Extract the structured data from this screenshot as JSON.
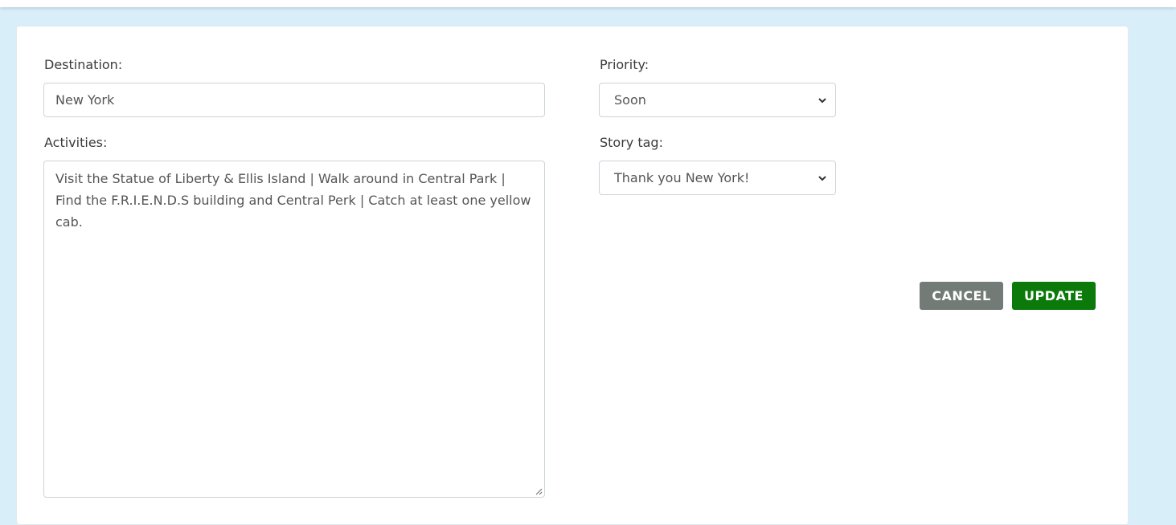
{
  "form": {
    "destination": {
      "label": "Destination:",
      "value": "New York"
    },
    "activities": {
      "label": "Activities:",
      "value": "Visit the Statue of Liberty & Ellis Island | Walk around in Central Park | Find the F.R.I.E.N.D.S building and Central Perk | Catch at least one yellow cab."
    },
    "priority": {
      "label": "Priority:",
      "selected": "Soon"
    },
    "story_tag": {
      "label": "Story tag:",
      "selected": "Thank you New York!"
    },
    "buttons": {
      "cancel_label": "CANCEL",
      "update_label": "UPDATE"
    }
  },
  "colors": {
    "page_background": "#d8eef9",
    "cancel_button": "#727b76",
    "update_button": "#0b7a0b"
  }
}
